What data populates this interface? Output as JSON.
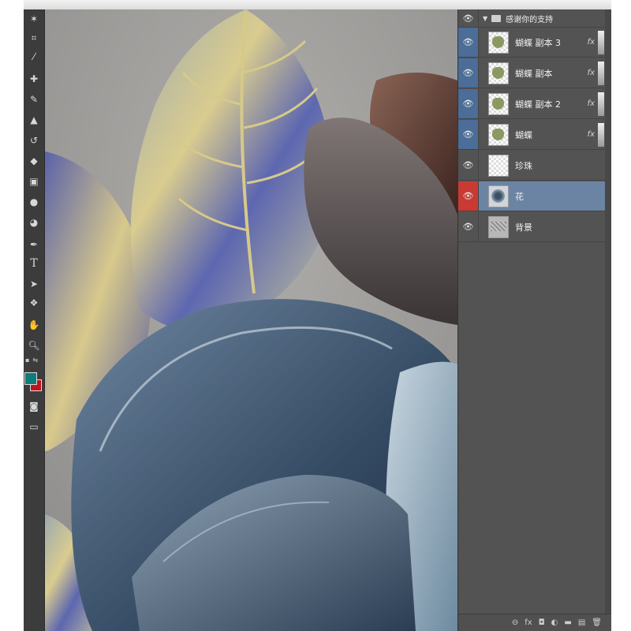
{
  "layers_panel": {
    "group": {
      "name": "感谢你的支持",
      "expanded_icon": "triangle-down-icon",
      "folder_icon": "folder-icon"
    },
    "layers": [
      {
        "name": "蝴蝶 副本 3",
        "thumb": "butterfly",
        "fx": "fx",
        "eye_color": "#4b6d97",
        "selected": false
      },
      {
        "name": "蝴蝶 副本",
        "thumb": "butterfly",
        "fx": "fx",
        "eye_color": "#4b6d97",
        "selected": false
      },
      {
        "name": "蝴蝶 副本 2",
        "thumb": "butterfly",
        "fx": "fx",
        "eye_color": "#4b6d97",
        "selected": false
      },
      {
        "name": "蝴蝶",
        "thumb": "butterfly",
        "fx": "fx",
        "eye_color": "#4b6d97",
        "selected": false
      },
      {
        "name": "珍珠",
        "thumb": "transparent",
        "fx": "",
        "eye_color": "#535353",
        "selected": false
      },
      {
        "name": "花",
        "thumb": "flower",
        "fx": "",
        "eye_color": "#c83a32",
        "selected": true
      },
      {
        "name": "背景",
        "thumb": "bg",
        "fx": "",
        "eye_color": "#535353",
        "selected": false
      }
    ],
    "bottom_icons": [
      "link-icon",
      "fx-icon",
      "mask-icon",
      "adjustment-icon",
      "folder-icon",
      "new-layer-icon",
      "trash-icon"
    ]
  },
  "toolbar": {
    "tools": [
      "magic-wand-icon",
      "crop-icon",
      "eyedropper-icon",
      "healing-brush-icon",
      "brush-icon",
      "clone-stamp-icon",
      "history-brush-icon",
      "eraser-icon",
      "gradient-icon",
      "blur-icon",
      "dodge-icon",
      "pen-icon",
      "type-icon",
      "path-select-icon",
      "shape-icon",
      "hand-icon",
      "zoom-icon"
    ],
    "type_glyph": "T",
    "foreground_color": "#0d7d7b",
    "background_color": "#c8101b"
  },
  "colors": {
    "panel_bg": "#535353",
    "toolbar_bg": "#3c3c3c",
    "selected_row": "#6b84a3"
  }
}
